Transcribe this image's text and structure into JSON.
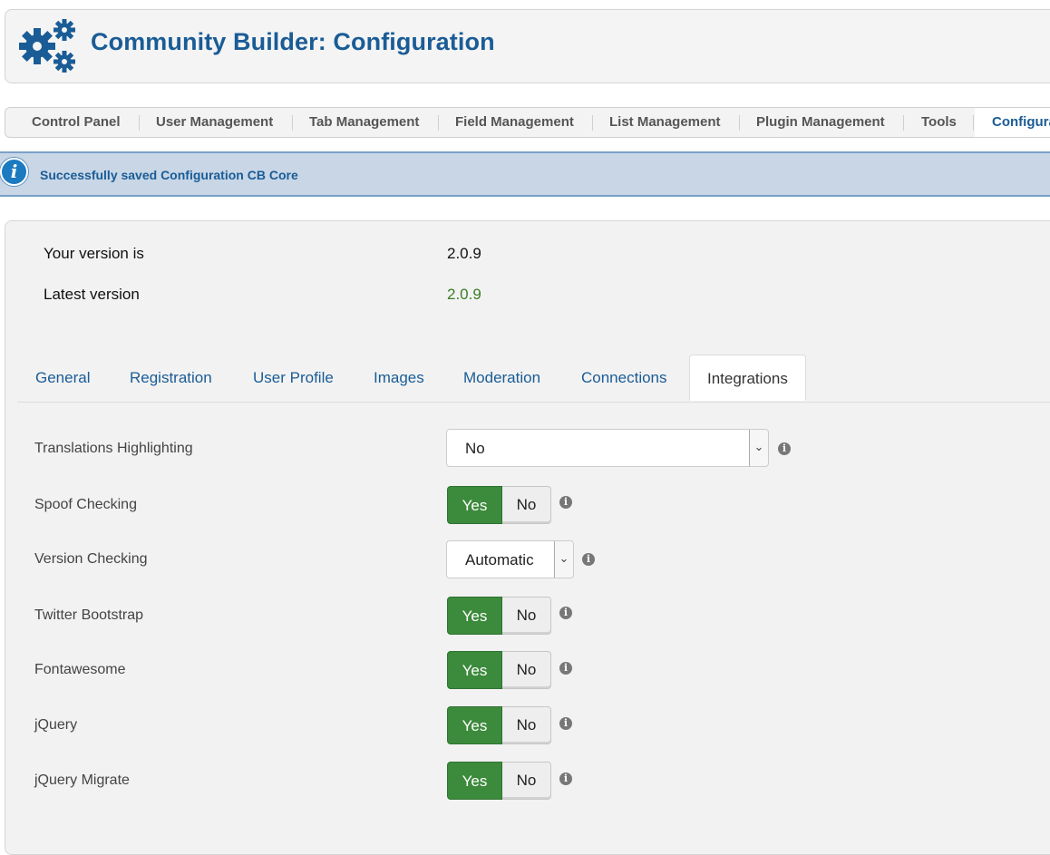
{
  "header": {
    "title": "Community Builder: Configuration",
    "logo_icon": "gears-icon"
  },
  "topnav": {
    "items": [
      "Control Panel",
      "User Management",
      "Tab Management",
      "Field Management",
      "List Management",
      "Plugin Management",
      "Tools",
      "Configura"
    ]
  },
  "alert": {
    "message": "Successfully saved Configuration CB Core",
    "icon": "info-icon"
  },
  "version": {
    "your_label": "Your version is",
    "your_value": "2.0.9",
    "latest_label": "Latest version",
    "latest_value": "2.0.9",
    "latest_color": "#3b7d23"
  },
  "tabs": [
    "General",
    "Registration",
    "User Profile",
    "Images",
    "Moderation",
    "Connections",
    "Integrations"
  ],
  "active_tab": "Integrations",
  "settings": [
    {
      "label": "Translations Highlighting",
      "type": "select",
      "value": "No"
    },
    {
      "label": "Spoof Checking",
      "type": "toggle",
      "yes": "Yes",
      "no": "No",
      "selected": "Yes"
    },
    {
      "label": "Version Checking",
      "type": "select",
      "value": "Automatic"
    },
    {
      "label": "Twitter Bootstrap",
      "type": "toggle",
      "yes": "Yes",
      "no": "No",
      "selected": "Yes"
    },
    {
      "label": "Fontawesome",
      "type": "toggle",
      "yes": "Yes",
      "no": "No",
      "selected": "Yes"
    },
    {
      "label": "jQuery",
      "type": "toggle",
      "yes": "Yes",
      "no": "No",
      "selected": "Yes"
    },
    {
      "label": "jQuery Migrate",
      "type": "toggle",
      "yes": "Yes",
      "no": "No",
      "selected": "Yes"
    }
  ],
  "colors": {
    "accent": "#1a5c96",
    "toggle_on": "#3c8a3c",
    "alert_bg": "#c8d6e6"
  }
}
